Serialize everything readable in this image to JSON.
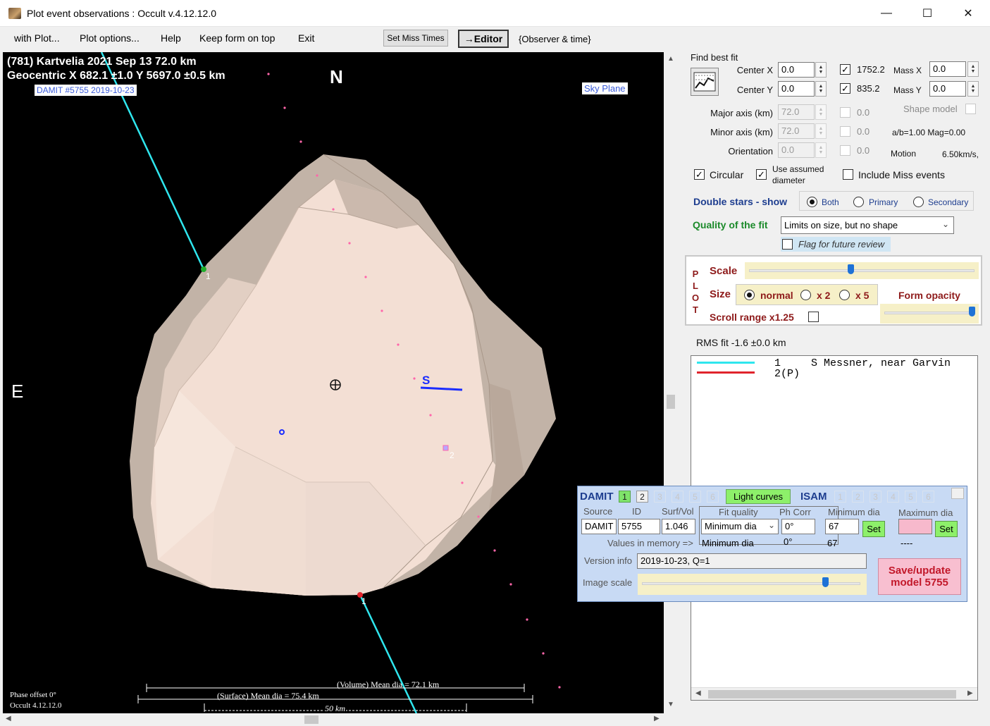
{
  "window": {
    "title": "Plot event observations : Occult v.4.12.12.0",
    "minimize_glyph": "—",
    "maximize_glyph": "☐",
    "close_glyph": "✕"
  },
  "menu": {
    "items": [
      "with Plot...",
      "Plot options...",
      "Help",
      "Keep form on top",
      "Exit"
    ],
    "set_miss_times": "Set Miss Times",
    "editor": "→Editor",
    "observer_time": "{Observer & time}"
  },
  "plot": {
    "title": "(781) Kartvelia  2021 Sep 13   72.0 km",
    "geocentric": "Geocentric  X  682.1 ±1.0  Y 5697.0 ±0.5 km",
    "damit_label": "DAMIT #5755 2019-10-23",
    "sky_plane": "Sky Plane",
    "north": "N",
    "east": "E",
    "chord1_label": "1",
    "chord1_label_b": "1",
    "event2_label": "2",
    "s_marker": "S",
    "volume_mean": "(Volume) Mean dia = 72.1 km",
    "surface_mean": "(Surface) Mean dia = 75.4 km",
    "scale_50": "50 km",
    "phase_offset": "Phase offset 0°",
    "occult_version": "Occult 4.12.12.0"
  },
  "fit": {
    "find_best_fit": "Find best fit",
    "center_x_label": "Center X",
    "center_x": "0.0",
    "center_y_label": "Center Y",
    "center_y": "0.0",
    "chk1_value": "1752.2",
    "chk2_value": "835.2",
    "mass_x_label": "Mass X",
    "mass_x": "0.0",
    "mass_y_label": "Mass Y",
    "mass_y": "0.0",
    "major_axis_label": "Major axis (km)",
    "major_axis": "72.0",
    "minor_axis_label": "Minor axis (km)",
    "minor_axis": "72.0",
    "orientation_label": "Orientation",
    "orientation": "0.0",
    "dis_val1": "0.0",
    "dis_val2": "0.0",
    "dis_val3": "0.0",
    "shape_model": "Shape model",
    "ab_mag": "a/b=1.00  Mag=0.00",
    "motion_label": "Motion",
    "motion_value": "6.50km/s,",
    "circular": "Circular",
    "use_assumed_1": "Use assumed",
    "use_assumed_2": "diameter",
    "include_miss": "Include Miss events"
  },
  "double_stars": {
    "label": "Double stars - show",
    "options": [
      "Both",
      "Primary",
      "Secondary"
    ]
  },
  "quality": {
    "label": "Quality of the fit",
    "selected": "Limits on size, but no shape",
    "flag": "Flag for future review"
  },
  "plot_panel": {
    "letters": [
      "P",
      "L",
      "O",
      "T"
    ],
    "scale": "Scale",
    "size": "Size",
    "size_options": [
      "normal",
      "x 2",
      "x 5"
    ],
    "form_opacity": "Form opacity",
    "scroll_range": "Scroll range x1.25",
    "scale_level": 0.45,
    "opacity_level": 0.97
  },
  "rms": "RMS fit -1.6 ±0.0 km",
  "observers": [
    {
      "num": "1",
      "name": "S Messner, near Garvin",
      "color": "#2fe6ee"
    },
    {
      "num": "2(P)",
      "name": "",
      "color": "#e0242c"
    }
  ],
  "damit": {
    "title": "DAMIT",
    "tabs": [
      "1",
      "2",
      "3",
      "4",
      "5",
      "6"
    ],
    "light_curves": "Light curves",
    "isam": "ISAM",
    "isam_tabs": [
      "1",
      "2",
      "3",
      "4",
      "5",
      "6"
    ],
    "source_label": "Source",
    "id_label": "ID",
    "surfvol_label": "Surf/Vol",
    "fit_quality_label": "Fit quality",
    "ph_corr_label": "Ph Corr",
    "min_dia_label": "Minimum dia",
    "max_dia_label": "Maximum dia",
    "source": "DAMIT",
    "id": "5755",
    "surfvol": "1.046",
    "fit_quality": "Minimum dia",
    "ph_corr": "0°",
    "min_dia": "67",
    "set": "Set",
    "values_in_memory": "Values in memory =>",
    "mem_fit_quality": "Minimum dia",
    "mem_ph_corr": "0°",
    "mem_min_dia": "67",
    "mem_max_dia": "----",
    "version_label": "Version info",
    "version": "2019-10-23, Q=1",
    "image_scale_label": "Image scale",
    "image_scale_level": 0.84,
    "save_update": "Save/update model 5755"
  }
}
